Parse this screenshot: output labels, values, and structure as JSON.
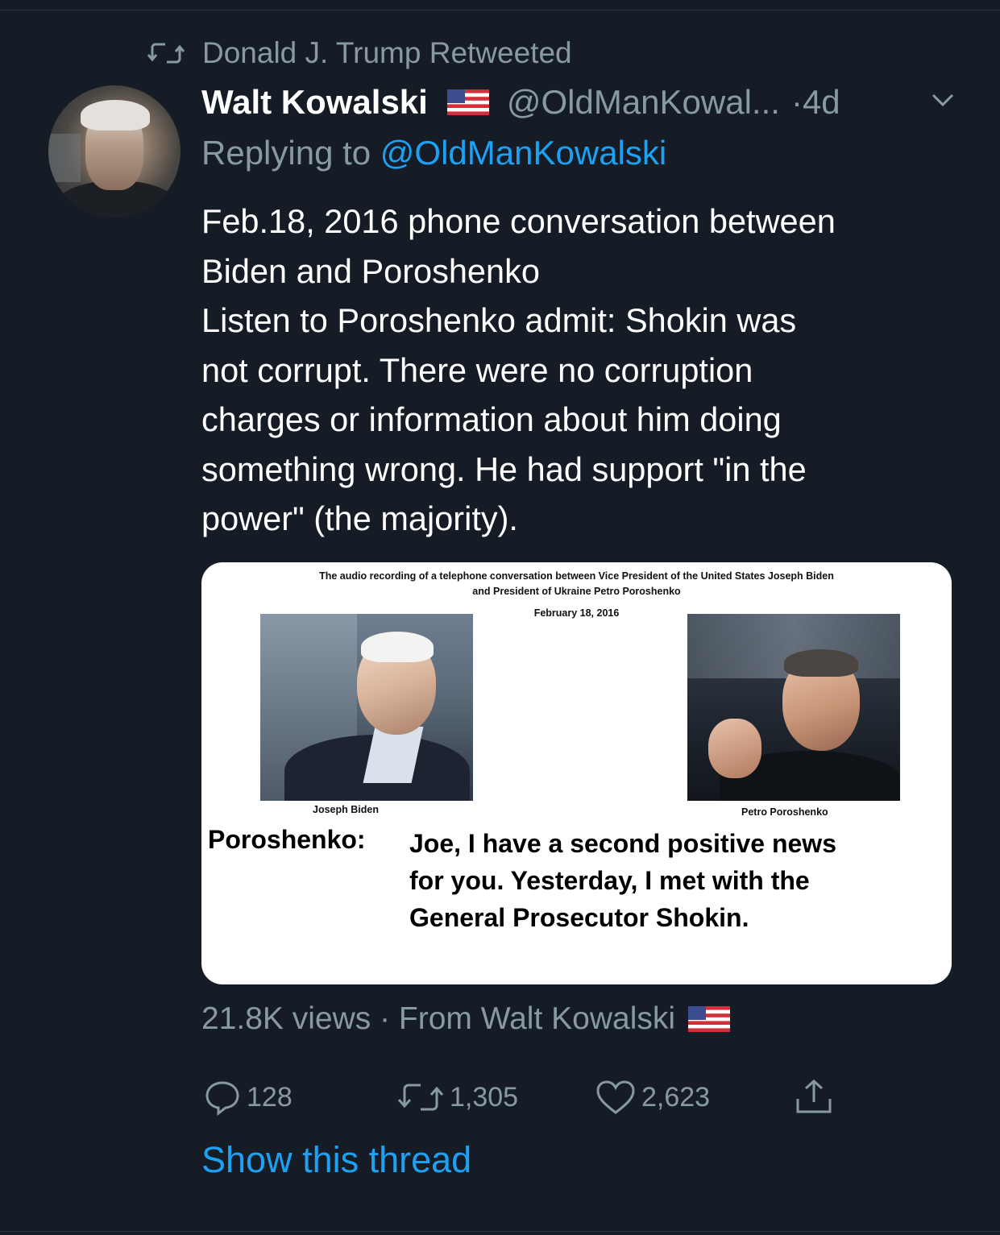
{
  "retweet": {
    "label": "Donald J. Trump Retweeted"
  },
  "author": {
    "name": "Walt Kowalski",
    "handle": "@OldManKowal...",
    "separator": "·",
    "time": "4d"
  },
  "reply": {
    "prefix": "Replying to",
    "mention": "@OldManKowalski"
  },
  "tweet": {
    "lines": [
      "Feb.18, 2016 phone conversation between",
      "Biden and Poroshenko",
      "Listen to Poroshenko admit: Shokin was",
      "not corrupt. There were no corruption",
      "charges or information about him doing",
      "something wrong. He had support \"in the",
      "power\" (the majority)."
    ]
  },
  "media": {
    "caption_line1": "The audio recording of a telephone conversation between Vice President of the United States Joseph Biden",
    "caption_line2": "and President of Ukraine Petro Poroshenko",
    "date": "February 18, 2016",
    "left_label": "Joseph Biden",
    "right_label": "Petro Poroshenko",
    "speaker": "Poroshenko:",
    "quote_lines": [
      "Joe, I have a second positive news",
      "for you. Yesterday, I met with the",
      "General Prosecutor Shokin."
    ]
  },
  "meta": {
    "views": "21.8K views · From Walt Kowalski"
  },
  "actions": {
    "replies": "128",
    "retweets": "1,305",
    "likes": "2,623"
  },
  "thread_link": "Show this thread",
  "icons": [
    "retweet-icon",
    "flag-us-icon",
    "chevron-down-icon",
    "reply-icon",
    "heart-icon",
    "share-icon"
  ]
}
